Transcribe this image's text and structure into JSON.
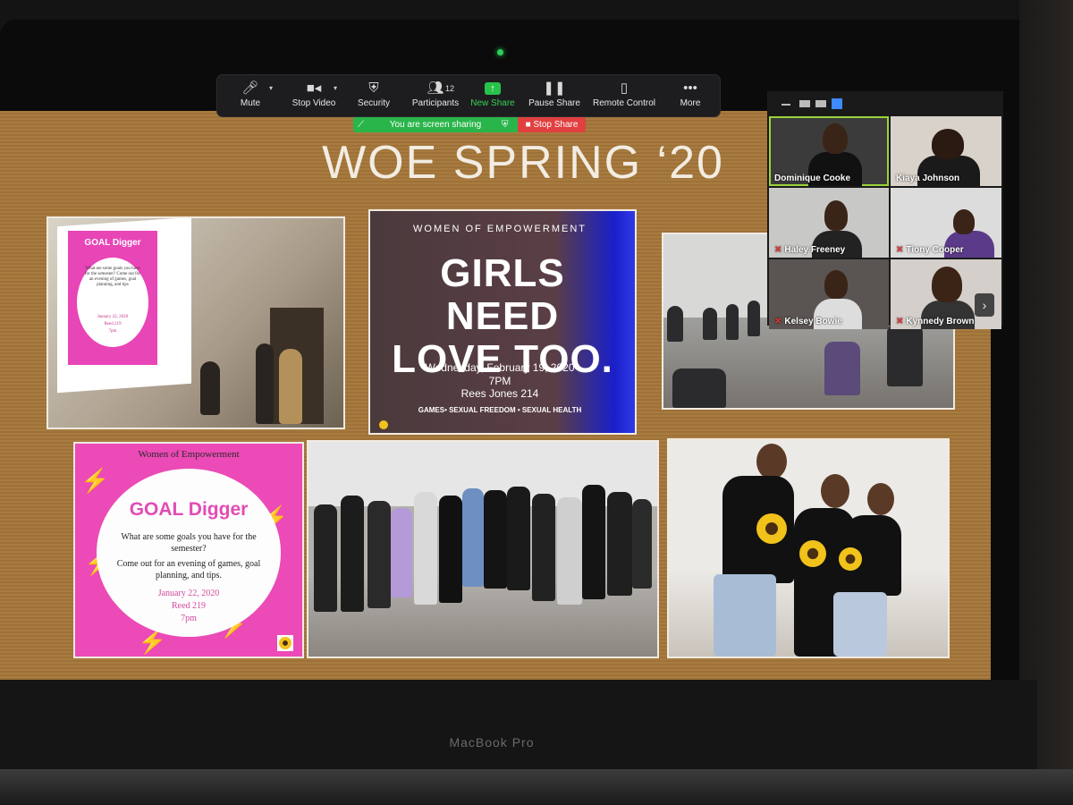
{
  "slide": {
    "title": "WOE SPRING ‘20"
  },
  "toolbar": {
    "buttons": [
      {
        "label": "Mute",
        "icon": "microphone-icon"
      },
      {
        "label": "Stop Video",
        "icon": "video-camera-icon"
      },
      {
        "label": "Security",
        "icon": "shield-icon"
      },
      {
        "label": "Participants",
        "icon": "participants-icon",
        "count": "12"
      },
      {
        "label": "New Share",
        "icon": "share-arrow-icon"
      },
      {
        "label": "Pause Share",
        "icon": "pause-icon"
      },
      {
        "label": "Remote Control",
        "icon": "mouse-icon"
      },
      {
        "label": "More",
        "icon": "more-dots-icon"
      }
    ],
    "accent": "#36d157"
  },
  "sharing": {
    "status": "You are screen sharing",
    "stop_label": "Stop Share"
  },
  "flyer": {
    "kicker": "WOMEN OF EMPOWERMENT",
    "headline_1": "GIRLS NEED",
    "headline_2": "LOVE TOO.",
    "date": "Wednesday, February 19, 2020",
    "time": "7PM",
    "place": "Rees Jones 214",
    "tags": "GAMES• SEXUAL FREEDOM • SEXUAL HEALTH"
  },
  "goal_flyer": {
    "org": "Women of Empowerment",
    "title": "GOAL Digger",
    "question": "What are some goals you have for the semester?",
    "invite": "Come out for an evening of games, goal planning, and tips.",
    "date": "January 22, 2020",
    "room": "Reed 219",
    "time": "7pm"
  },
  "goal_flyer_small": {
    "title": "GOAL Digger",
    "body": "What are some goals you have for the semester? Come out for an evening of games, goal planning, and tips",
    "date": "January 22, 2020",
    "room": "Reed 219",
    "time": "7pm"
  },
  "participants": [
    {
      "name": "Dominique Cooke",
      "muted": false,
      "active": true
    },
    {
      "name": "Kiaya Johnson",
      "muted": false,
      "active": false
    },
    {
      "name": "Haley Freeney",
      "muted": true,
      "active": false
    },
    {
      "name": "Tiony Cooper",
      "muted": true,
      "active": false
    },
    {
      "name": "Kelsey Bowie",
      "muted": true,
      "active": false
    },
    {
      "name": "Kynnedy Brown",
      "muted": true,
      "active": false
    }
  ],
  "laptop": {
    "brand": "MacBook Pro"
  }
}
